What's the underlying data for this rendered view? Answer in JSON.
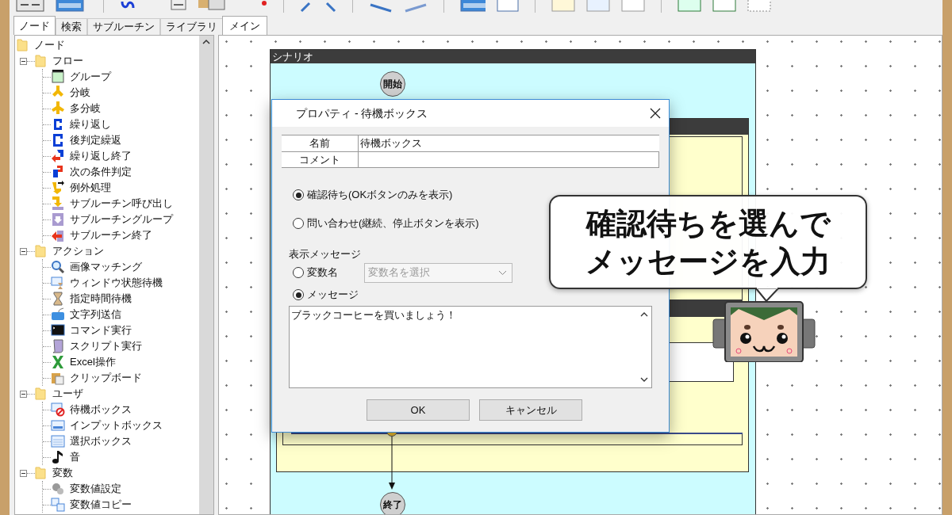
{
  "left_panel": {
    "tabs": [
      {
        "label": "ノード",
        "selected": true
      },
      {
        "label": "検索",
        "selected": false
      },
      {
        "label": "サブルーチン",
        "selected": false
      },
      {
        "label": "ライブラリ",
        "selected": false
      }
    ],
    "tree": [
      {
        "label": "ノード",
        "children": [
          {
            "label": "フロー",
            "expanded": true,
            "children": [
              {
                "label": "グループ"
              },
              {
                "label": "分岐"
              },
              {
                "label": "多分岐"
              },
              {
                "label": "繰り返し"
              },
              {
                "label": "後判定繰返"
              },
              {
                "label": "繰り返し終了"
              },
              {
                "label": "次の条件判定"
              },
              {
                "label": "例外処理"
              },
              {
                "label": "サブルーチン呼び出し"
              },
              {
                "label": "サブルーチングループ"
              },
              {
                "label": "サブルーチン終了"
              }
            ]
          },
          {
            "label": "アクション",
            "expanded": true,
            "children": [
              {
                "label": "画像マッチング"
              },
              {
                "label": "ウィンドウ状態待機"
              },
              {
                "label": "指定時間待機"
              },
              {
                "label": "文字列送信"
              },
              {
                "label": "コマンド実行"
              },
              {
                "label": "スクリプト実行"
              },
              {
                "label": "Excel操作"
              },
              {
                "label": "クリップボード"
              }
            ]
          },
          {
            "label": "ユーザ",
            "expanded": true,
            "children": [
              {
                "label": "待機ボックス"
              },
              {
                "label": "インプットボックス"
              },
              {
                "label": "選択ボックス"
              },
              {
                "label": "音"
              }
            ]
          },
          {
            "label": "変数",
            "expanded": true,
            "children": [
              {
                "label": "変数値設定"
              },
              {
                "label": "変数値コピー"
              }
            ]
          }
        ]
      }
    ]
  },
  "main_tabs": [
    {
      "label": "メイン",
      "selected": true
    }
  ],
  "scenario": {
    "title": "シナリオ",
    "start": "開始",
    "end": "終了"
  },
  "dialog": {
    "title": "プロパティ - 待機ボックス",
    "fields": [
      {
        "label": "名前",
        "value": "待機ボックス"
      },
      {
        "label": "コメント"
      }
    ],
    "modes": [
      {
        "label": "確認待ち(OKボタンのみを表示)",
        "selected": true
      },
      {
        "label": "問い合わせ(継続、停止ボタンを表示)",
        "selected": false
      }
    ],
    "message_label": "表示メッセージ",
    "sources": [
      {
        "kind": "variable",
        "label": "変数名",
        "selected": false,
        "placeholder": "変数名を選択"
      },
      {
        "kind": "text",
        "label": "メッセージ",
        "selected": true
      }
    ],
    "message": "ブラックコーヒーを買いましょう！",
    "buttons": [
      "OK",
      "キャンセル"
    ]
  },
  "callout": {
    "lines": [
      "確認待ちを選んで",
      "メッセージを入力"
    ]
  }
}
